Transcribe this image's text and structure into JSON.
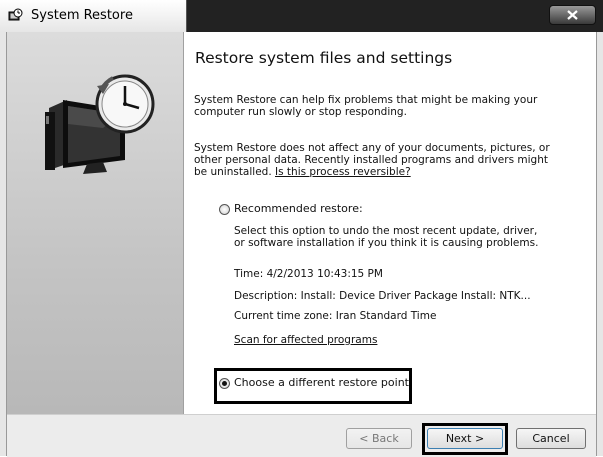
{
  "window": {
    "title": "System Restore"
  },
  "content": {
    "heading": "Restore system files and settings",
    "intro": "System Restore can help fix problems that might be making your computer run slowly or stop responding.",
    "privacy_text": "System Restore does not affect any of your documents, pictures, or other personal data. Recently installed programs and drivers might be uninstalled.",
    "reversible_link": "Is this process reversible?",
    "options": {
      "recommended": {
        "label": "Recommended restore:",
        "selected": false,
        "description": "Select this option to undo the most recent update, driver, or software installation if you think it is causing problems.",
        "time": "Time: 4/2/2013 10:43:15 PM",
        "restore_description": "Description: Install: Device Driver Package Install: NTK...",
        "time_zone": "Current time zone: Iran Standard Time",
        "scan_link": "Scan for affected programs"
      },
      "choose": {
        "label": "Choose a different restore point",
        "selected": true
      }
    }
  },
  "buttons": {
    "back": "< Back",
    "next": "Next >",
    "cancel": "Cancel"
  },
  "icons": {
    "title": "system-restore-icon",
    "side": "restore-clock-monitor-icon"
  }
}
